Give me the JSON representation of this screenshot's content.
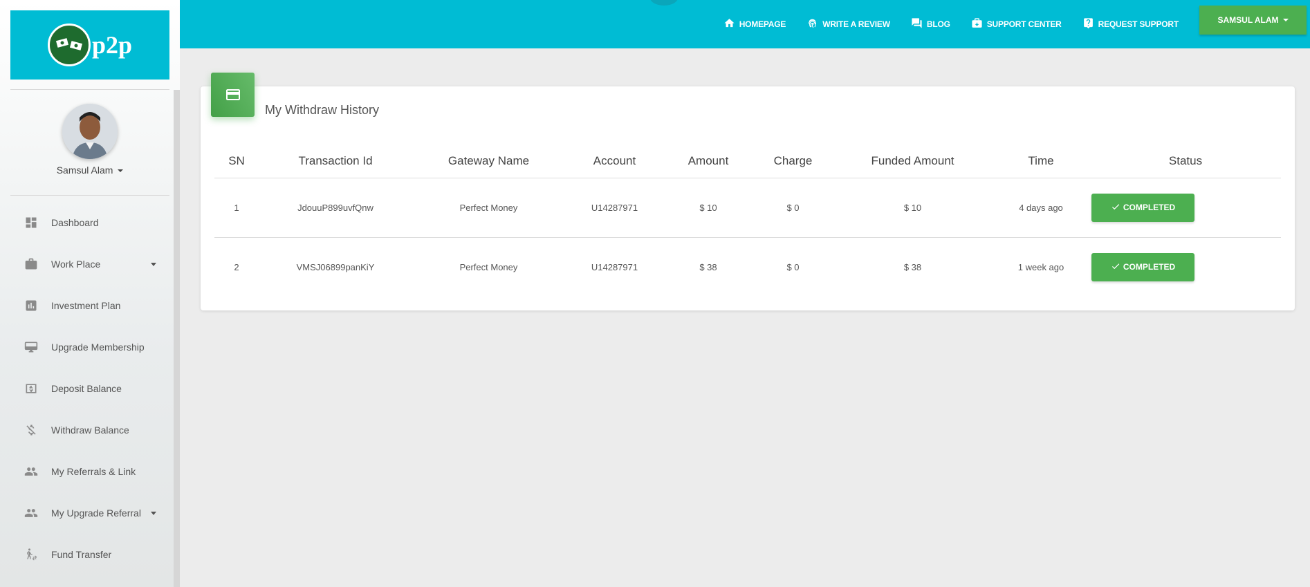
{
  "brand": {
    "logo_text": "p2p"
  },
  "user": {
    "name": "Samsul Alam"
  },
  "sidebar": {
    "items": [
      {
        "label": "Dashboard",
        "icon": "dashboard-icon",
        "has_caret": false
      },
      {
        "label": "Work Place",
        "icon": "briefcase-icon",
        "has_caret": true
      },
      {
        "label": "Investment Plan",
        "icon": "bar-chart-icon",
        "has_caret": false
      },
      {
        "label": "Upgrade Membership",
        "icon": "monitor-icon",
        "has_caret": false
      },
      {
        "label": "Deposit Balance",
        "icon": "money-icon",
        "has_caret": false
      },
      {
        "label": "Withdraw Balance",
        "icon": "money-off-icon",
        "has_caret": false
      },
      {
        "label": "My Referrals & Link",
        "icon": "people-icon",
        "has_caret": false
      },
      {
        "label": "My Upgrade Referral",
        "icon": "people-icon",
        "has_caret": true
      },
      {
        "label": "Fund Transfer",
        "icon": "transfer-icon",
        "has_caret": false
      }
    ]
  },
  "nav": {
    "links": [
      {
        "label": "HOMEPAGE",
        "icon": "home-icon"
      },
      {
        "label": "WRITE A REVIEW",
        "icon": "fingerprint-icon"
      },
      {
        "label": "BLOG",
        "icon": "forum-icon"
      },
      {
        "label": "SUPPORT CENTER",
        "icon": "inbox-icon"
      },
      {
        "label": "REQUEST SUPPORT",
        "icon": "help-icon"
      }
    ],
    "user_button": "SAMSUL ALAM"
  },
  "card": {
    "title": "My Withdraw History",
    "icon": "credit-card-icon",
    "columns": [
      "SN",
      "Transaction Id",
      "Gateway Name",
      "Account",
      "Amount",
      "Charge",
      "Funded Amount",
      "Time",
      "Status"
    ],
    "rows": [
      {
        "sn": "1",
        "txid": "JdouuP899uvfQnw",
        "gateway": "Perfect Money",
        "account": "U14287971",
        "amount": "$ 10",
        "charge": "$ 0",
        "funded": "$ 10",
        "time": "4 days ago",
        "status": "COMPLETED"
      },
      {
        "sn": "2",
        "txid": "VMSJ06899panKiY",
        "gateway": "Perfect Money",
        "account": "U14287971",
        "amount": "$ 38",
        "charge": "$ 0",
        "funded": "$ 38",
        "time": "1 week ago",
        "status": "COMPLETED"
      }
    ]
  },
  "colors": {
    "topbar": "#00bcd4",
    "accent_green": "#4caf50"
  }
}
